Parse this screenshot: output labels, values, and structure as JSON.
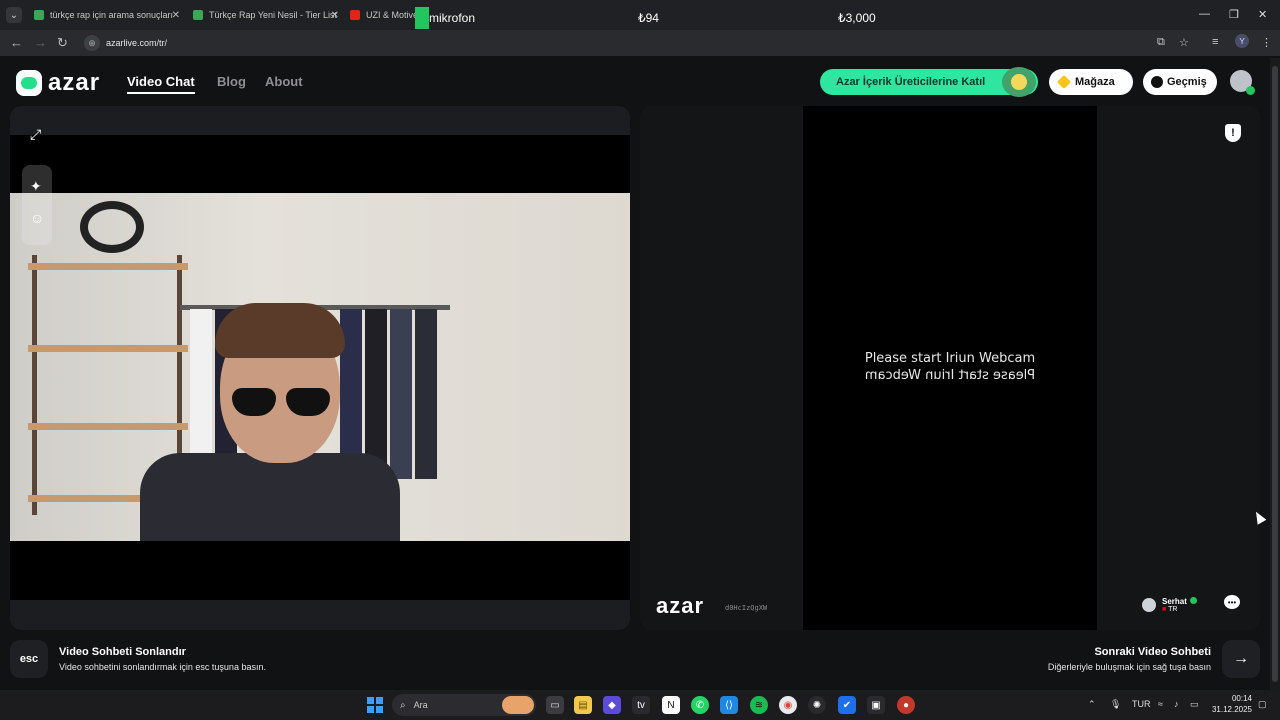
{
  "browser": {
    "tabs": [
      {
        "title": "türkçe rap için arama sonuçları",
        "favicon_color": "#3aa757"
      },
      {
        "title": "Türkçe Rap Yeni Nesil - Tier List",
        "favicon_color": "#3aa757"
      },
      {
        "title": "UZI & Motive",
        "favicon_color": "#e62117"
      }
    ],
    "overlay_mic_label": "mikrofon",
    "overlay_value_1": "₺94",
    "overlay_value_2": "₺3,000",
    "url": "azarlive.com/tr/",
    "profile_initial": "Y"
  },
  "header": {
    "logo_text": "azar",
    "nav": [
      "Video Chat",
      "Blog",
      "About"
    ],
    "creator_button": "Azar İçerik Üreticilerine Katıl",
    "shop_button": "Mağaza",
    "history_button": "Geçmiş"
  },
  "remote": {
    "message_line_1": "Please start Iriun Webcam",
    "message_line_2": "Please start Iriun Webcam",
    "watermark_logo": "azar",
    "watermark_id": "d0HcIzQgXW",
    "peer_name": "Serhat",
    "peer_country": "TR"
  },
  "footer": {
    "esc_key": "esc",
    "end_title": "Video Sohbeti Sonlandır",
    "end_desc": "Video sohbetini sonlandırmak için esc tuşuna basın.",
    "next_title": "Sonraki Video Sohbeti",
    "next_desc": "Diğerleriyle buluşmak için sağ tuşa basın"
  },
  "taskbar": {
    "search_placeholder": "Ara",
    "language": "TUR",
    "time": "00:14",
    "date": "31.12.2025"
  },
  "colors": {
    "accent": "#2ee6a0",
    "background": "#111214"
  }
}
